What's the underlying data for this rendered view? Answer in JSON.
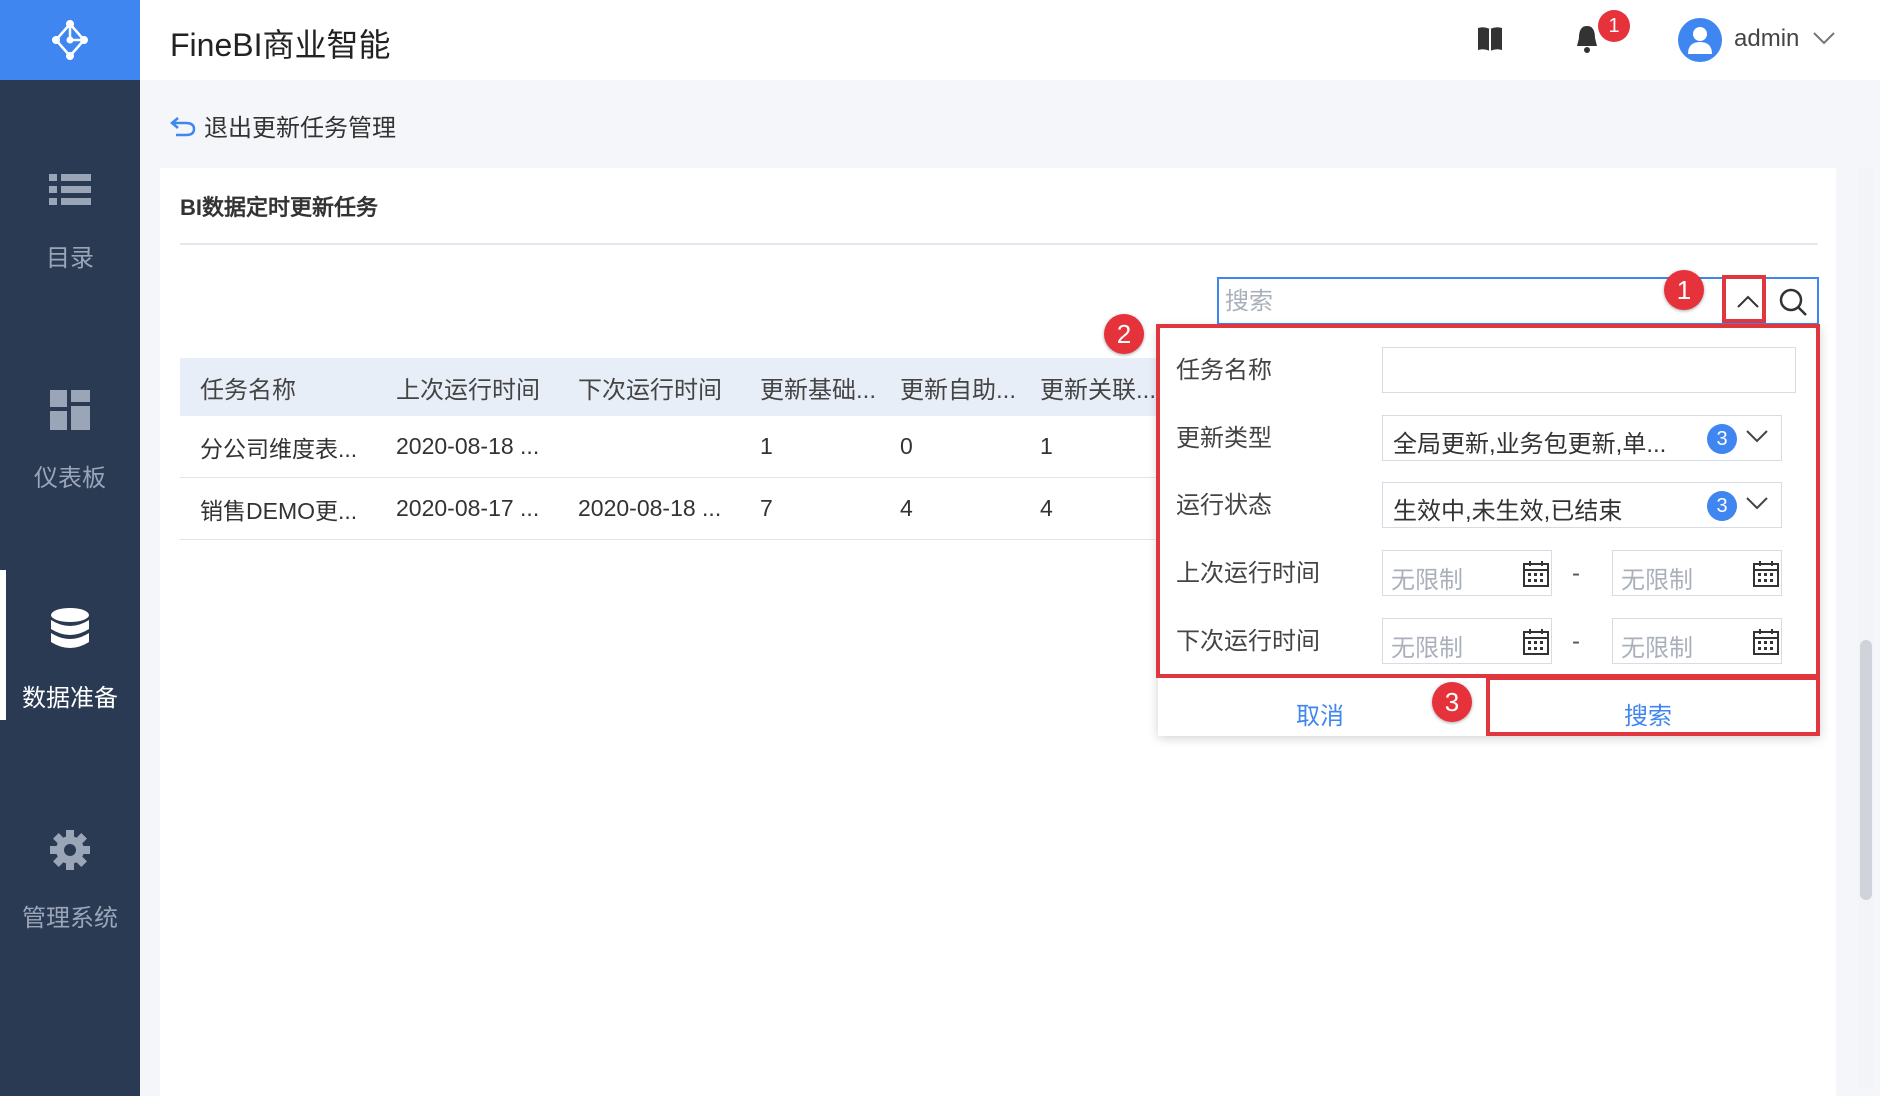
{
  "app": {
    "title": "FineBI商业智能",
    "user": "admin",
    "notification_count": "1"
  },
  "sidebar": {
    "items": [
      {
        "label": "目录",
        "icon": "list-icon"
      },
      {
        "label": "仪表板",
        "icon": "dashboard-icon"
      },
      {
        "label": "数据准备",
        "icon": "database-icon",
        "active": true
      },
      {
        "label": "管理系统",
        "icon": "gear-icon"
      }
    ]
  },
  "breadcrumb": {
    "back_label": "退出更新任务管理"
  },
  "card": {
    "title": "BI数据定时更新任务"
  },
  "search": {
    "placeholder": "搜索"
  },
  "table": {
    "headers": [
      "任务名称",
      "上次运行时间",
      "下次运行时间",
      "更新基础...",
      "更新自助...",
      "更新关联..."
    ],
    "rows": [
      [
        "分公司维度表...",
        "2020-08-18 ...",
        "",
        "1",
        "0",
        "1"
      ],
      [
        "销售DEMO更...",
        "2020-08-17 ...",
        "2020-08-18 ...",
        "7",
        "4",
        "4"
      ]
    ]
  },
  "filter": {
    "task_name_label": "任务名称",
    "task_name_value": "",
    "update_type_label": "更新类型",
    "update_type_value": "全局更新,业务包更新,单...",
    "update_type_count": "3",
    "run_status_label": "运行状态",
    "run_status_value": "生效中,未生效,已结束",
    "run_status_count": "3",
    "last_run_label": "上次运行时间",
    "next_run_label": "下次运行时间",
    "date_placeholder": "无限制",
    "date_separator": "-",
    "cancel_label": "取消",
    "search_label": "搜索"
  },
  "annotations": {
    "m1": "1",
    "m2": "2",
    "m3": "3"
  },
  "colors": {
    "accent": "#3f86f0",
    "sidebar": "#2b3a53",
    "highlight": "#e0363d"
  }
}
